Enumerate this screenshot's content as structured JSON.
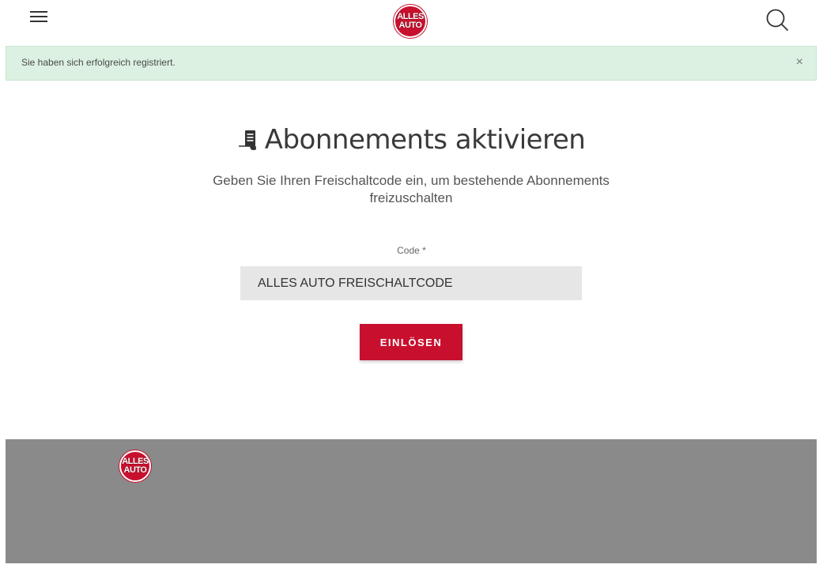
{
  "header": {
    "logo": {
      "line1": "ALLES",
      "line2": "AUTO"
    },
    "menu_icon": "hamburger-menu-icon",
    "search_icon": "search-icon"
  },
  "alert": {
    "message": "Sie haben sich erfolgreich registriert.",
    "close_label": "×"
  },
  "main": {
    "title_icon": "document-icon",
    "title": "Abonnements aktivieren",
    "subtitle": "Geben Sie Ihren Freischaltcode ein, um bestehende Abonnements freizuschalten",
    "code_label": "Code *",
    "code_value": "ALLES AUTO FREISCHALTCODE",
    "submit_label": "EINLÖSEN"
  },
  "footer": {
    "logo": {
      "line1": "ALLES",
      "line2": "AUTO"
    }
  },
  "colors": {
    "brand": "#c8102e",
    "alert_bg": "#dcf1e1",
    "footer_bg": "#8a8a8a"
  }
}
